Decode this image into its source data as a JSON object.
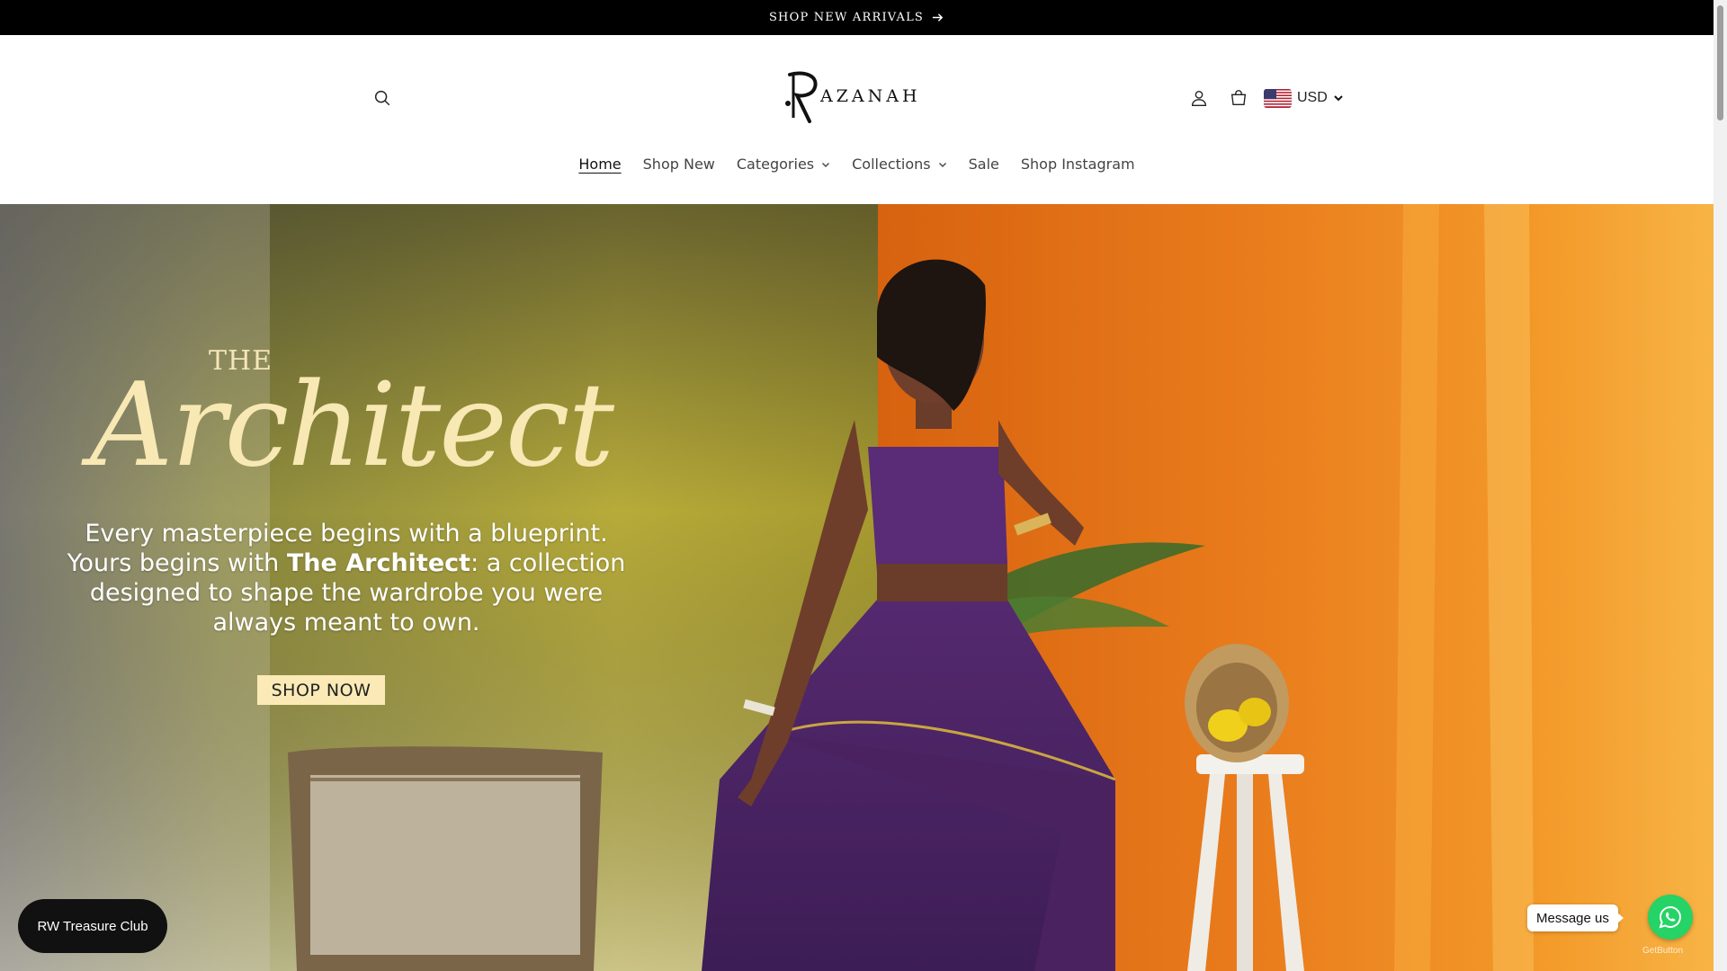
{
  "announcement": {
    "text": "SHOP NEW ARRIVALS",
    "arrow_icon": "arrow-right-icon"
  },
  "header": {
    "logo_text": "AZANAH",
    "logo_initial": "R",
    "icons": {
      "search": "search-icon",
      "account": "user-icon",
      "cart": "bag-icon",
      "flag": "us-flag-icon"
    },
    "currency": "USD"
  },
  "nav": {
    "items": [
      {
        "label": "Home",
        "active": true
      },
      {
        "label": "Shop New"
      },
      {
        "label": "Categories",
        "dropdown": true
      },
      {
        "label": "Collections",
        "dropdown": true
      },
      {
        "label": "Sale"
      },
      {
        "label": "Shop Instagram"
      }
    ]
  },
  "hero": {
    "the": "THE",
    "script_title": "Architect",
    "copy": {
      "line1": "Every masterpiece begins with a blueprint.",
      "line2_pre": "Yours begins with ",
      "line2_bold": "The Architect",
      "line2_post": ": a collection",
      "line3": "designed to shape the wardrobe you were",
      "line4": "always meant to own."
    },
    "cta": "SHOP NOW"
  },
  "widgets": {
    "treasure_club": "RW Treasure Club",
    "message": "Message us",
    "whatsapp_icon": "whatsapp-icon",
    "getbutton": "GetButton"
  },
  "colors": {
    "announcement_bg": "#000000",
    "cta_bg": "#fbeab5",
    "script_color": "#f8e8b4",
    "whatsapp": "#25d366",
    "dress_purple": "#4b2466",
    "orange_wall": "#e5781c",
    "olive_wall": "#b3a63a"
  }
}
